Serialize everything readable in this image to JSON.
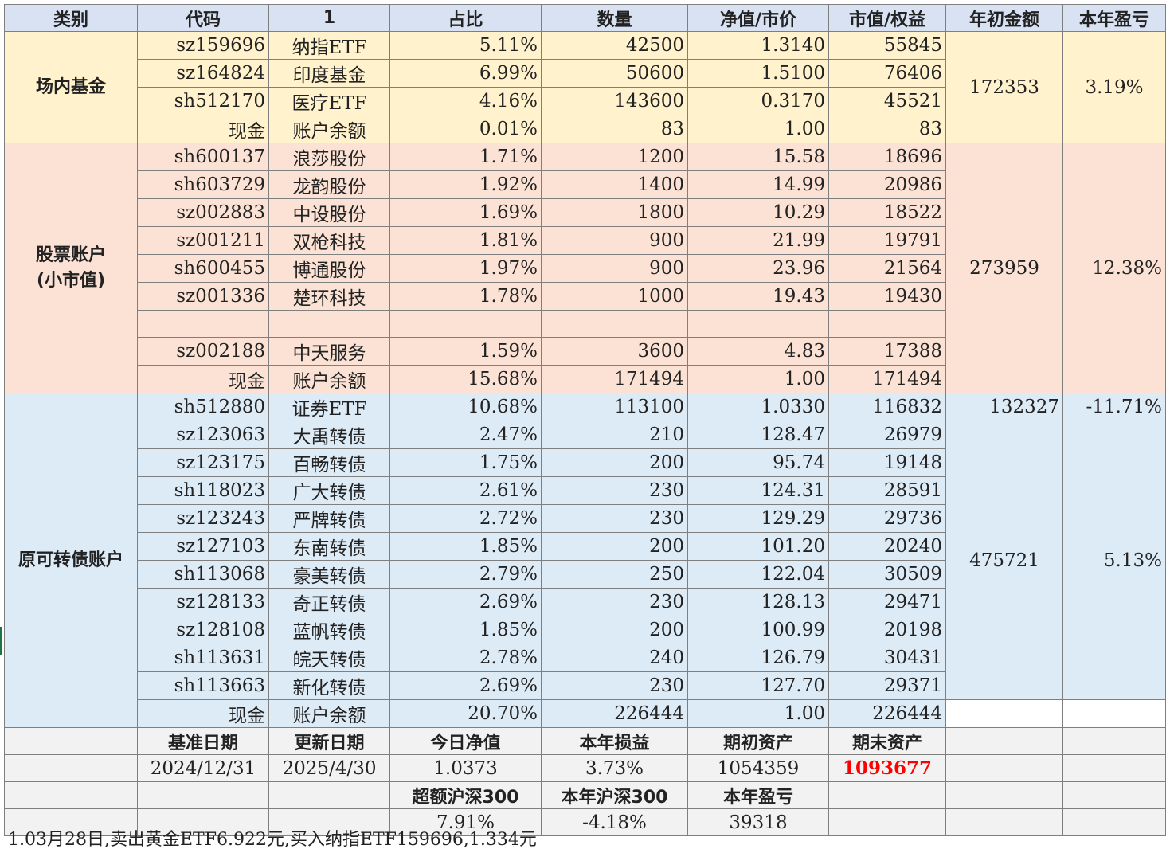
{
  "header": [
    "类别",
    "代码",
    "1",
    "占比",
    "数量",
    "净值/市价",
    "市值/权益",
    "年初金额",
    "本年盈亏"
  ],
  "groups": {
    "fund": {
      "category": "场内基金",
      "start_amount": "172353",
      "pnl": "3.19%",
      "rows": [
        [
          "sz159696",
          "纳指ETF",
          "5.11%",
          "42500",
          "1.3140",
          "55845"
        ],
        [
          "sz164824",
          "印度基金",
          "6.99%",
          "50600",
          "1.5100",
          "76406"
        ],
        [
          "sh512170",
          "医疗ETF",
          "4.16%",
          "143600",
          "0.3170",
          "45521"
        ],
        [
          "现金",
          "账户余额",
          "0.01%",
          "83",
          "1.00",
          "83"
        ]
      ]
    },
    "stock": {
      "category_line1": "股票账户",
      "category_line2": "(小市值)",
      "start_amount": "273959",
      "pnl": "12.38%",
      "rows": [
        [
          "sh600137",
          "浪莎股份",
          "1.71%",
          "1200",
          "15.58",
          "18696"
        ],
        [
          "sh603729",
          "龙韵股份",
          "1.92%",
          "1400",
          "14.99",
          "20986"
        ],
        [
          "sz002883",
          "中设股份",
          "1.69%",
          "1800",
          "10.29",
          "18522"
        ],
        [
          "sz001211",
          "双枪科技",
          "1.81%",
          "900",
          "21.99",
          "19791"
        ],
        [
          "sh600455",
          "博通股份",
          "1.97%",
          "900",
          "23.96",
          "21564"
        ],
        [
          "sz001336",
          "楚环科技",
          "1.78%",
          "1000",
          "19.43",
          "19430"
        ],
        [
          "",
          "",
          "",
          "",
          "",
          ""
        ],
        [
          "sz002188",
          "中天服务",
          "1.59%",
          "3600",
          "4.83",
          "17388"
        ],
        [
          "现金",
          "账户余额",
          "15.68%",
          "171494",
          "1.00",
          "171494"
        ]
      ]
    },
    "bond": {
      "category": "原可转债账户",
      "etf_row": [
        "sh512880",
        "证券ETF",
        "10.68%",
        "113100",
        "1.0330",
        "116832"
      ],
      "etf_start_amount": "132327",
      "etf_pnl": "-11.71%",
      "start_amount": "475721",
      "pnl": "5.13%",
      "rows": [
        [
          "sz123063",
          "大禹转债",
          "2.47%",
          "210",
          "128.47",
          "26979"
        ],
        [
          "sz123175",
          "百畅转债",
          "1.75%",
          "200",
          "95.74",
          "19148"
        ],
        [
          "sh118023",
          "广大转债",
          "2.61%",
          "230",
          "124.31",
          "28591"
        ],
        [
          "sz123243",
          "严牌转债",
          "2.72%",
          "230",
          "129.29",
          "29736"
        ],
        [
          "sz127103",
          "东南转债",
          "1.85%",
          "200",
          "101.20",
          "20240"
        ],
        [
          "sh113068",
          "豪美转债",
          "2.79%",
          "250",
          "122.04",
          "30509"
        ],
        [
          "sz128133",
          "奇正转债",
          "2.69%",
          "230",
          "128.13",
          "29471"
        ],
        [
          "sz128108",
          "蓝帆转债",
          "1.85%",
          "200",
          "100.99",
          "20198"
        ],
        [
          "sh113631",
          "皖天转债",
          "2.78%",
          "240",
          "126.79",
          "30431"
        ],
        [
          "sh113663",
          "新化转债",
          "2.69%",
          "230",
          "127.70",
          "29371"
        ]
      ],
      "cash_row": [
        "现金",
        "账户余额",
        "20.70%",
        "226444",
        "1.00",
        "226444"
      ]
    }
  },
  "summary": {
    "labels1": [
      "基准日期",
      "更新日期",
      "今日净值",
      "本年损益",
      "期初资产",
      "期末资产"
    ],
    "values1": [
      "2024/12/31",
      "2025/4/30",
      "1.0373",
      "3.73%",
      "1054359",
      "1093677"
    ],
    "labels2": [
      "超额沪深300",
      "本年沪深300",
      "本年盈亏"
    ],
    "values2": [
      "7.91%",
      "-4.18%",
      "39318"
    ]
  },
  "note": "1.03月28日,卖出黄金ETF6.922元,买入纳指ETF159696,1.334元",
  "colors": {
    "header": "#d9e2f3",
    "fund": "#fff2cc",
    "stock": "#fbe2d5",
    "bond": "#ddebf7",
    "summary": "#f2f2f2",
    "highlight": "#ff0000"
  }
}
